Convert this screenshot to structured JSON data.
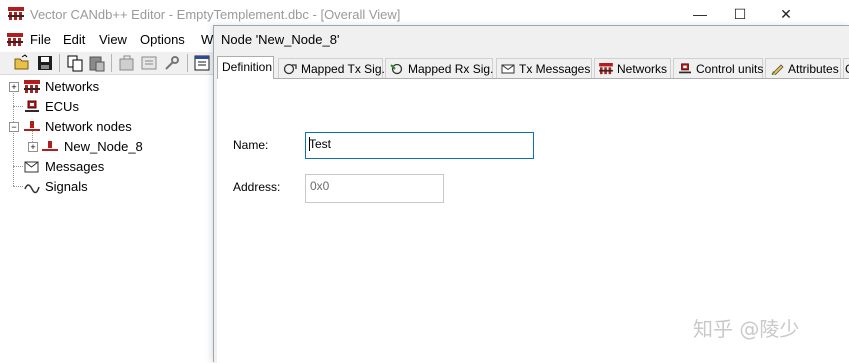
{
  "app": {
    "title": "Vector CANdb++ Editor - EmptyTemplement.dbc - [Overall View]",
    "window_controls": {
      "minimize": "—",
      "maximize": "☐",
      "close": "✕"
    }
  },
  "menu": {
    "items": [
      "File",
      "Edit",
      "View",
      "Options",
      "W"
    ]
  },
  "toolbar": {
    "buttons": [
      "open-folder-icon",
      "save-disk-icon",
      "copy-icon",
      "paste-icon",
      "properties-icon",
      "list-icon",
      "tools-icon",
      "table-icon"
    ]
  },
  "tree": {
    "items": [
      {
        "label": "Networks",
        "icon": "networks-icon"
      },
      {
        "label": "ECUs",
        "icon": "ecu-icon"
      },
      {
        "label": "Network nodes",
        "icon": "network-node-icon"
      },
      {
        "label": "New_Node_8",
        "icon": "network-node-icon"
      },
      {
        "label": "Messages",
        "icon": "envelope-icon"
      },
      {
        "label": "Signals",
        "icon": "signal-wave-icon"
      }
    ],
    "expanders": {
      "networks": "+",
      "network_nodes": "−",
      "new_node": "+"
    }
  },
  "dialog": {
    "title": "Node 'New_Node_8'",
    "tabs": [
      {
        "label": "Definition"
      },
      {
        "label": "Mapped Tx Sig."
      },
      {
        "label": "Mapped Rx Sig."
      },
      {
        "label": "Tx Messages"
      },
      {
        "label": "Networks"
      },
      {
        "label": "Control units"
      },
      {
        "label": "Attributes"
      },
      {
        "label": "C"
      }
    ],
    "fields": {
      "name_label": "Name:",
      "name_value": "Test",
      "address_label": "Address:",
      "address_value": "0x0"
    }
  },
  "colors": {
    "input_focus_border": "#0d6fb8",
    "icon_red": "#b01e1e"
  },
  "watermark": "知乎 @陵少"
}
